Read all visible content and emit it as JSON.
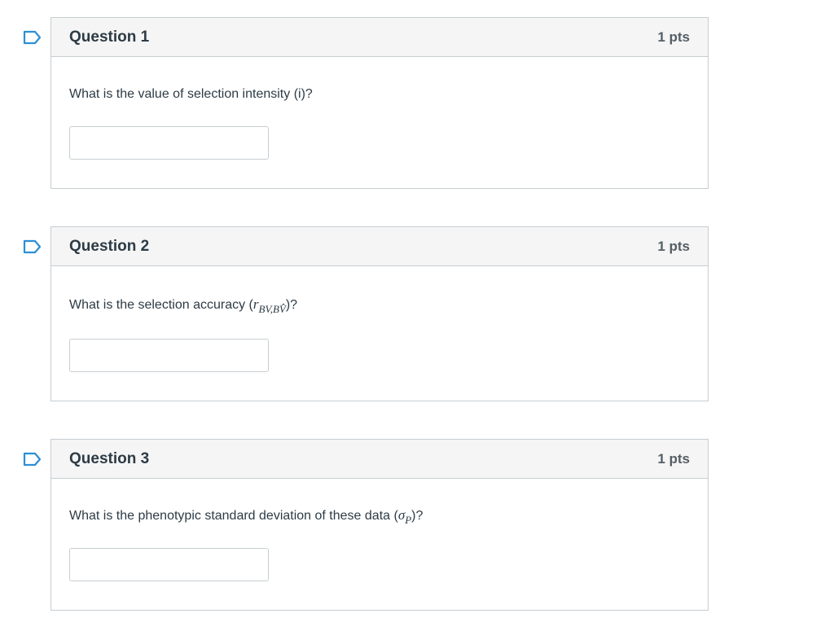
{
  "questions": [
    {
      "title": "Question 1",
      "points": "1 pts",
      "prompt": "What is the value of selection intensity (i)?",
      "answer_value": "",
      "flag_icon": "bookmark-flag-icon"
    },
    {
      "title": "Question 2",
      "points": "1 pts",
      "prompt_prefix": "What is the selection accuracy (",
      "prompt_math_r": "r",
      "prompt_math_sub": "BV,BV̂",
      "prompt_suffix": ")?",
      "answer_value": "",
      "flag_icon": "bookmark-flag-icon"
    },
    {
      "title": "Question 3",
      "points": "1 pts",
      "prompt_prefix": "What is the phenotypic standard deviation of these data (",
      "prompt_math_sigma": "σ",
      "prompt_math_sub": "P",
      "prompt_suffix": ")?",
      "answer_value": "",
      "flag_icon": "bookmark-flag-icon"
    }
  ],
  "colors": {
    "flag": "#2d8fd5",
    "header_bg": "#f5f5f5",
    "border": "#c7cdd1",
    "text": "#2d3b45"
  }
}
